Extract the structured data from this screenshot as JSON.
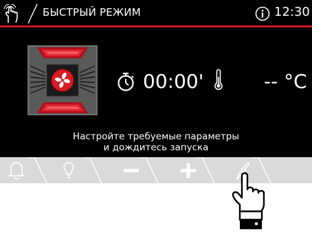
{
  "header": {
    "title": "БЫСТРЫЙ РЕЖИМ",
    "time": "12:30",
    "icons": [
      "hand-touch-icon",
      "info-icon"
    ]
  },
  "program": {
    "icon": "fan-icon",
    "colors": {
      "accent": "#d01820",
      "frame": "#606060"
    }
  },
  "timer": {
    "icon": "stopwatch-icon",
    "value": "00:00'"
  },
  "temperature": {
    "icon": "thermometer-icon",
    "value": "-- °C"
  },
  "message": {
    "line1": "Настройте требуемые параметры",
    "line2": "и дождитесь запуска"
  },
  "bottom_bar": {
    "items": [
      "bell-icon",
      "bulb-icon",
      "minus-icon",
      "plus-icon",
      "pen-icon"
    ]
  },
  "pointer": {
    "icon": "pointing-hand-icon"
  }
}
